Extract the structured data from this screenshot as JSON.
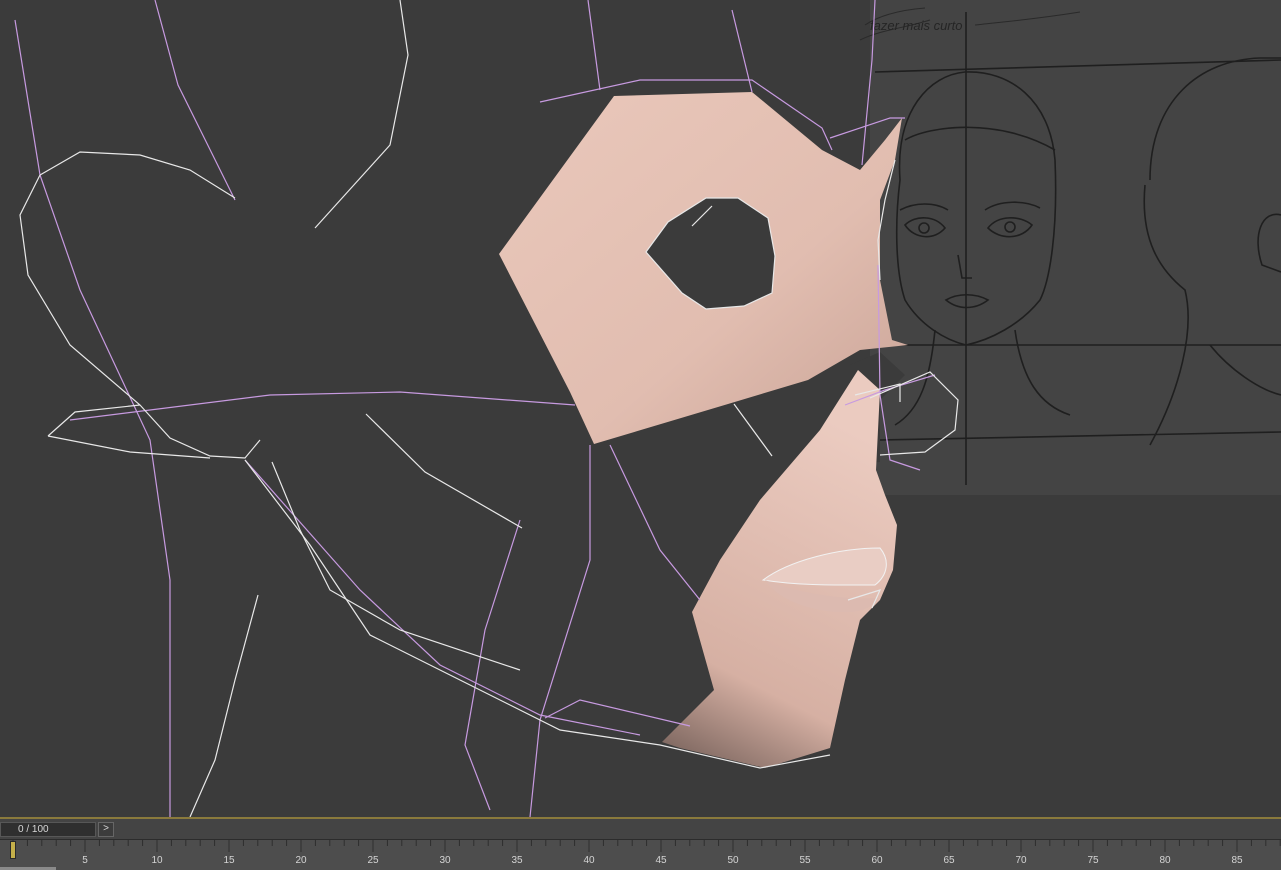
{
  "viewport": {
    "background": "#3b3b3b",
    "wire_white": "#e8e8e8",
    "wire_purple": "#c79ae0",
    "skin_color": "#e2bfb2",
    "sketch_note": "fazer mais curto"
  },
  "timeline": {
    "frame_display": "0 / 100",
    "next_label": ">",
    "accent": "#8a7a3c",
    "ticks": [
      "5",
      "10",
      "15",
      "20",
      "25",
      "30",
      "35",
      "40",
      "45",
      "50",
      "55",
      "60",
      "65",
      "70",
      "75",
      "80",
      "85"
    ]
  }
}
